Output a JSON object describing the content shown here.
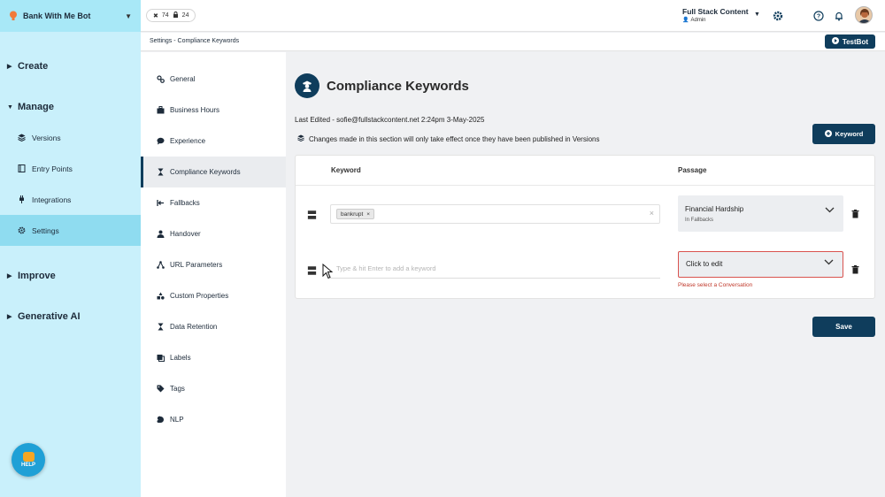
{
  "sidebar": {
    "bot_name": "Bank With Me Bot",
    "sections": [
      {
        "label": "Create"
      },
      {
        "label": "Manage",
        "items": [
          {
            "label": "Versions",
            "icon": "layers-icon"
          },
          {
            "label": "Entry Points",
            "icon": "book-icon"
          },
          {
            "label": "Integrations",
            "icon": "plug-icon"
          },
          {
            "label": "Settings",
            "icon": "gear-icon",
            "active": true
          }
        ]
      },
      {
        "label": "Improve"
      },
      {
        "label": "Generative AI"
      }
    ],
    "help_label": "HELP"
  },
  "topbar": {
    "stat_a": "74",
    "stat_b": "24",
    "user_name": "Full Stack Content",
    "user_role": "Admin"
  },
  "breadcrumb": "Settings - Compliance Keywords",
  "testbot_label": "TestBot",
  "settings_menu": [
    {
      "label": "General",
      "icon": "gears-icon"
    },
    {
      "label": "Business Hours",
      "icon": "briefcase-icon"
    },
    {
      "label": "Experience",
      "icon": "chat-icon"
    },
    {
      "label": "Compliance Keywords",
      "icon": "hourglass-icon",
      "active": true
    },
    {
      "label": "Fallbacks",
      "icon": "fallback-icon"
    },
    {
      "label": "Handover",
      "icon": "person-icon"
    },
    {
      "label": "URL Parameters",
      "icon": "network-icon"
    },
    {
      "label": "Custom Properties",
      "icon": "shapes-icon"
    },
    {
      "label": "Data Retention",
      "icon": "hourglass-icon"
    },
    {
      "label": "Labels",
      "icon": "labels-icon"
    },
    {
      "label": "Tags",
      "icon": "tags-icon"
    },
    {
      "label": "NLP",
      "icon": "brain-icon"
    }
  ],
  "main": {
    "title": "Compliance Keywords",
    "last_edited": "Last Edited - sofie@fullstackcontent.net 2:24pm 3-May-2025",
    "note": "Changes made in this section will only take effect once they have been published in Versions",
    "add_keyword_label": "Keyword",
    "col_keyword": "Keyword",
    "col_passage": "Passage",
    "rows": [
      {
        "chip": "bankrupt",
        "passage_title": "Financial Hardship",
        "passage_sub": "In Fallbacks"
      },
      {
        "placeholder": "Type & hit Enter to add a keyword",
        "passage_title": "Click to edit",
        "error": "Please select a Conversation"
      }
    ],
    "save_label": "Save"
  },
  "colors": {
    "sidebar_bg": "#c9f0fb",
    "primary": "#0f3d5c",
    "error": "#d9534f"
  }
}
